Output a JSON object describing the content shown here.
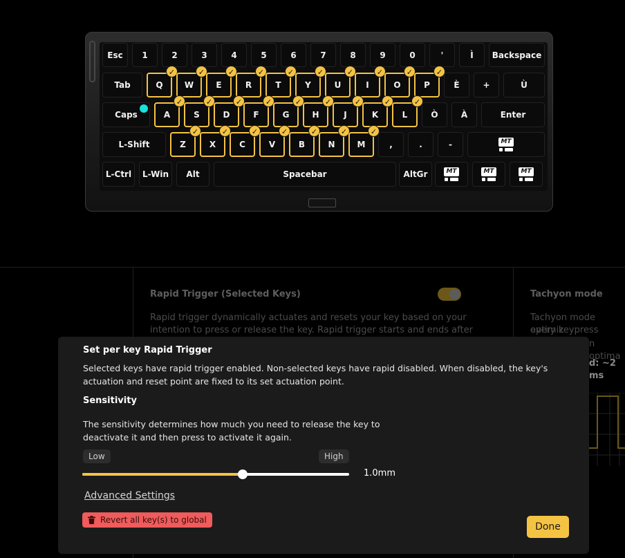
{
  "keyboard": {
    "caps_indicator_color": "#18e2de",
    "selected_color": "#f5c344",
    "rows": [
      [
        {
          "label": "Esc"
        },
        {
          "label": "1"
        },
        {
          "label": "2"
        },
        {
          "label": "3"
        },
        {
          "label": "4"
        },
        {
          "label": "5"
        },
        {
          "label": "6"
        },
        {
          "label": "7"
        },
        {
          "label": "8"
        },
        {
          "label": "9"
        },
        {
          "label": "0"
        },
        {
          "label": "'"
        },
        {
          "label": "Ì"
        },
        {
          "label": "Backspace"
        }
      ],
      [
        {
          "label": "Tab"
        },
        {
          "label": "Q",
          "selected": true
        },
        {
          "label": "W",
          "selected": true
        },
        {
          "label": "E",
          "selected": true
        },
        {
          "label": "R",
          "selected": true
        },
        {
          "label": "T",
          "selected": true
        },
        {
          "label": "Y",
          "selected": true
        },
        {
          "label": "U",
          "selected": true
        },
        {
          "label": "I",
          "selected": true
        },
        {
          "label": "O",
          "selected": true
        },
        {
          "label": "P",
          "selected": true
        },
        {
          "label": "È"
        },
        {
          "label": "+"
        },
        {
          "label": "Ù"
        }
      ],
      [
        {
          "label": "Caps"
        },
        {
          "label": "A",
          "selected": true
        },
        {
          "label": "S",
          "selected": true
        },
        {
          "label": "D",
          "selected": true
        },
        {
          "label": "F",
          "selected": true
        },
        {
          "label": "G",
          "selected": true
        },
        {
          "label": "H",
          "selected": true
        },
        {
          "label": "J",
          "selected": true
        },
        {
          "label": "K",
          "selected": true
        },
        {
          "label": "L",
          "selected": true
        },
        {
          "label": "Ò"
        },
        {
          "label": "À"
        },
        {
          "label": "Enter"
        }
      ],
      [
        {
          "label": "L-Shift"
        },
        {
          "label": "Z",
          "selected": true
        },
        {
          "label": "X",
          "selected": true
        },
        {
          "label": "C",
          "selected": true
        },
        {
          "label": "V",
          "selected": true
        },
        {
          "label": "B",
          "selected": true
        },
        {
          "label": "N",
          "selected": true
        },
        {
          "label": "M",
          "selected": true
        },
        {
          "label": ","
        },
        {
          "label": "."
        },
        {
          "label": "-"
        },
        {
          "label": "MT",
          "icon": "mt-icon"
        }
      ],
      [
        {
          "label": "L-Ctrl"
        },
        {
          "label": "L-Win"
        },
        {
          "label": "Alt"
        },
        {
          "label": "Spacebar"
        },
        {
          "label": "AltGr"
        },
        {
          "label": "MT",
          "icon": "mt-icon"
        },
        {
          "label": "MT",
          "icon": "mt-icon"
        },
        {
          "label": "MT",
          "icon": "mt-icon"
        }
      ]
    ]
  },
  "background": {
    "rapid_trigger_title": "Rapid Trigger (Selected Keys)",
    "rapid_trigger_desc_line1": "Rapid trigger dynamically actuates and resets your key based on your",
    "rapid_trigger_desc_line2": "intention to press or release the key. Rapid trigger starts and ends after",
    "toggle_on": true,
    "tachyon_title": "Tachyon mode",
    "tachyon_line1": "Tachyon mode optimiz",
    "tachyon_line2": "every keypress respon",
    "tachyon_line3": "n optima",
    "tachyon_line4": "d: ~2 ms"
  },
  "modal": {
    "title": "Set per key Rapid Trigger",
    "description_line1": "Selected keys have rapid trigger enabled. Non-selected keys have rapid disabled. When disabled, the key's",
    "description_line2": "actuation and reset point are fixed to its set actuation point.",
    "sensitivity_title": "Sensitivity",
    "sensitivity_desc_line1": "The sensitivity determines how much you need to release the key to",
    "sensitivity_desc_line2": "deactivate it and then press to activate it again.",
    "low_label": "Low",
    "high_label": "High",
    "slider_fraction": 0.6,
    "slider_value": "1.0mm",
    "advanced_label": "Advanced Settings",
    "revert_label": "Revert all key(s) to global",
    "done_label": "Done",
    "revert_color": "#f05b5b",
    "accent_color": "#f5c344"
  }
}
